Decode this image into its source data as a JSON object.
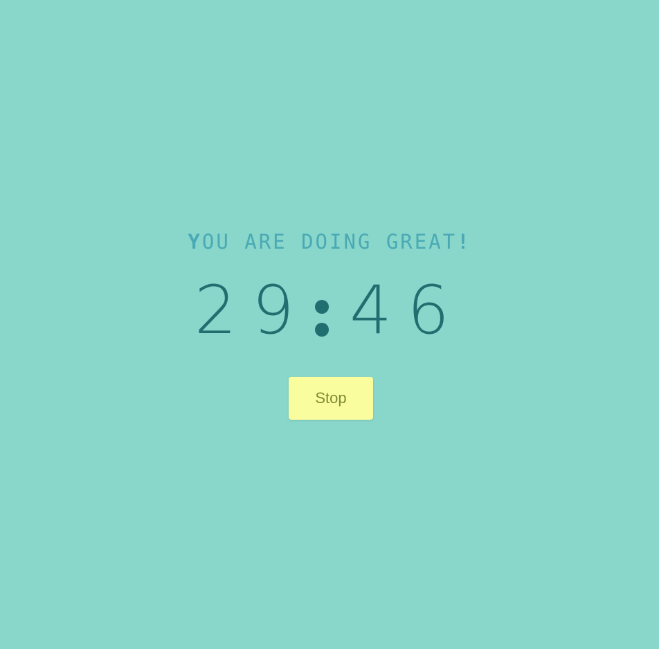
{
  "theme": {
    "background": "#89d7cb",
    "message_color": "#4aa9b4",
    "timer_color": "#216e70",
    "button_background": "#fafd9e",
    "button_text_color": "#7f8a35"
  },
  "message": {
    "lead": "Y",
    "body": "OU ARE DOING GREAT",
    "trail": "!"
  },
  "timer": {
    "minutes": "29",
    "seconds": "46"
  },
  "controls": {
    "stop_label": "Stop"
  }
}
